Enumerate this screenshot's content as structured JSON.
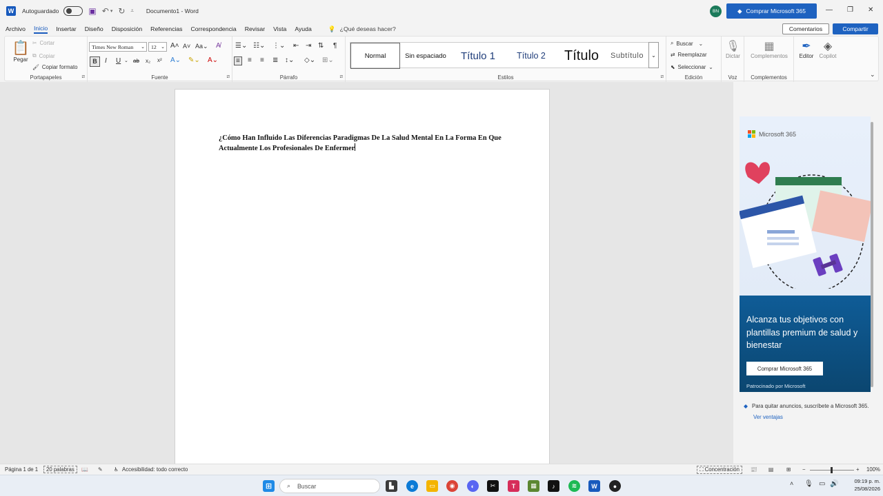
{
  "titlebar": {
    "autosave_label": "Autoguardado",
    "doc_title": "Documento1  -  Word",
    "avatar_initials": "BN",
    "buy_button": "Comprar Microsoft 365"
  },
  "menu": {
    "tabs": [
      "Archivo",
      "Inicio",
      "Insertar",
      "Diseño",
      "Disposición",
      "Referencias",
      "Correspondencia",
      "Revisar",
      "Vista",
      "Ayuda"
    ],
    "active_tab": "Inicio",
    "search_hint": "¿Qué deseas hacer?",
    "comments": "Comentarios",
    "share": "Compartir"
  },
  "ribbon": {
    "clipboard": {
      "paste": "Pegar",
      "cut": "Cortar",
      "copy": "Copiar",
      "format_painter": "Copiar formato",
      "label": "Portapapeles"
    },
    "font": {
      "name": "Times New Roman",
      "size": "12",
      "label": "Fuente"
    },
    "paragraph": {
      "label": "Párrafo"
    },
    "styles": {
      "items": [
        "Normal",
        "Sin espaciado",
        "Título 1",
        "Título 2",
        "Título",
        "Subtítulo"
      ],
      "selected": "Normal",
      "label": "Estilos"
    },
    "editing": {
      "find": "Buscar",
      "replace": "Reemplazar",
      "select": "Seleccionar",
      "label": "Edición"
    },
    "voice": {
      "dictate": "Dictar",
      "label": "Voz"
    },
    "addins": {
      "addins": "Complementos",
      "label": "Complementos"
    },
    "editor": "Editor",
    "copilot": "Copilot"
  },
  "document": {
    "text": "¿Cómo Han Influido Las Diferencias Paradigmas  De La Salud Mental En La Forma En Que Actualmente Los Profesionales De Enfermer"
  },
  "ad": {
    "brand": "Microsoft 365",
    "headline": "Alcanza tus objetivos con plantillas premium de salud y bienestar",
    "button": "Comprar Microsoft 365",
    "sponsor": "Patrocinado por Microsoft",
    "note": "Para quitar anuncios, suscríbete a Microsoft 365.",
    "link": "Ver ventajas"
  },
  "status": {
    "page": "Página 1 de 1",
    "words": "20 palabras",
    "accessibility": "Accesibilidad: todo correcto",
    "focus": "Concentración",
    "zoom": "100%"
  },
  "taskbar": {
    "search": "Buscar",
    "time": "09:19 p. m.",
    "date": "25/08/2026"
  },
  "colors": {
    "accent": "#185abd",
    "buy_button": "#1e62c0",
    "ad_panel": "#0f5c97"
  }
}
